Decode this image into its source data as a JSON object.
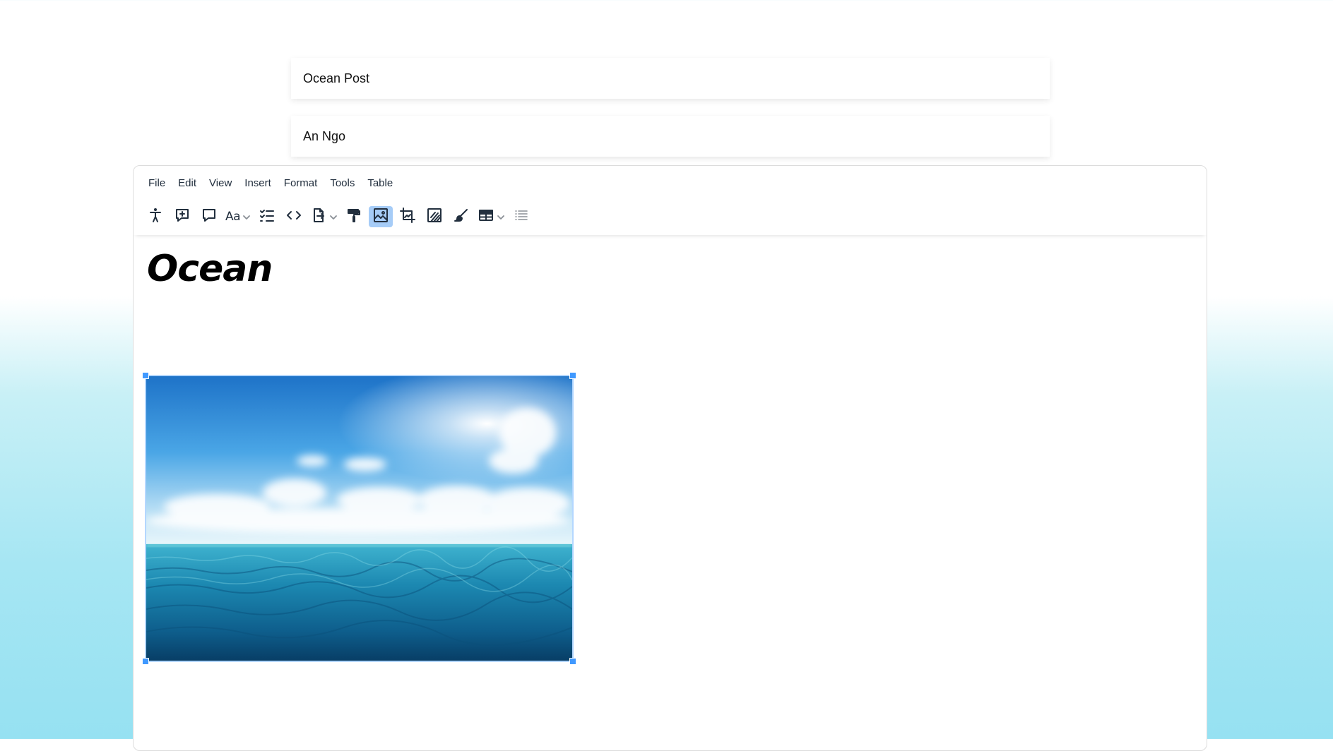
{
  "fields": {
    "post_title": "Ocean Post",
    "author": "An Ngo"
  },
  "menubar": [
    "File",
    "Edit",
    "View",
    "Insert",
    "Format",
    "Tools",
    "Table"
  ],
  "toolbar": {
    "items": [
      "accessibility-checker-icon",
      "add-comment-icon",
      "show-comments-icon",
      "font-format-icon",
      "checklist-icon",
      "source-code-icon",
      "export-icon",
      "format-painter-icon",
      "image-edit-icon",
      "crop-icon",
      "image-options-icon",
      "paint-brush-icon",
      "table-icon",
      "list-icon"
    ],
    "font_format_label": "Aa",
    "active_item": "image-edit-icon",
    "active_color": "#a6ccf7"
  },
  "content": {
    "heading": "Ocean",
    "image": {
      "subject": "ocean horizon with blue sky and clouds",
      "selected": true
    }
  },
  "colors": {
    "selection_handle": "#4099ff",
    "selection_outline": "#b4d7ff",
    "icon": "#222f3e"
  }
}
